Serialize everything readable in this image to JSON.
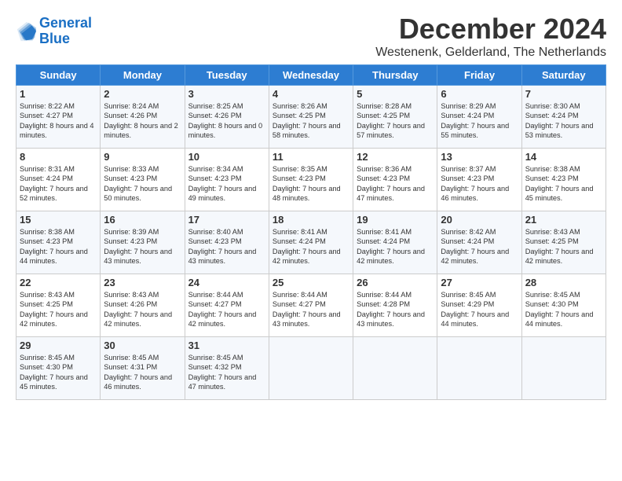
{
  "logo": {
    "line1": "General",
    "line2": "Blue"
  },
  "title": "December 2024",
  "subtitle": "Westenenk, Gelderland, The Netherlands",
  "days_of_week": [
    "Sunday",
    "Monday",
    "Tuesday",
    "Wednesday",
    "Thursday",
    "Friday",
    "Saturday"
  ],
  "weeks": [
    [
      {
        "day": "1",
        "sunrise": "Sunrise: 8:22 AM",
        "sunset": "Sunset: 4:27 PM",
        "daylight": "Daylight: 8 hours and 4 minutes."
      },
      {
        "day": "2",
        "sunrise": "Sunrise: 8:24 AM",
        "sunset": "Sunset: 4:26 PM",
        "daylight": "Daylight: 8 hours and 2 minutes."
      },
      {
        "day": "3",
        "sunrise": "Sunrise: 8:25 AM",
        "sunset": "Sunset: 4:26 PM",
        "daylight": "Daylight: 8 hours and 0 minutes."
      },
      {
        "day": "4",
        "sunrise": "Sunrise: 8:26 AM",
        "sunset": "Sunset: 4:25 PM",
        "daylight": "Daylight: 7 hours and 58 minutes."
      },
      {
        "day": "5",
        "sunrise": "Sunrise: 8:28 AM",
        "sunset": "Sunset: 4:25 PM",
        "daylight": "Daylight: 7 hours and 57 minutes."
      },
      {
        "day": "6",
        "sunrise": "Sunrise: 8:29 AM",
        "sunset": "Sunset: 4:24 PM",
        "daylight": "Daylight: 7 hours and 55 minutes."
      },
      {
        "day": "7",
        "sunrise": "Sunrise: 8:30 AM",
        "sunset": "Sunset: 4:24 PM",
        "daylight": "Daylight: 7 hours and 53 minutes."
      }
    ],
    [
      {
        "day": "8",
        "sunrise": "Sunrise: 8:31 AM",
        "sunset": "Sunset: 4:24 PM",
        "daylight": "Daylight: 7 hours and 52 minutes."
      },
      {
        "day": "9",
        "sunrise": "Sunrise: 8:33 AM",
        "sunset": "Sunset: 4:23 PM",
        "daylight": "Daylight: 7 hours and 50 minutes."
      },
      {
        "day": "10",
        "sunrise": "Sunrise: 8:34 AM",
        "sunset": "Sunset: 4:23 PM",
        "daylight": "Daylight: 7 hours and 49 minutes."
      },
      {
        "day": "11",
        "sunrise": "Sunrise: 8:35 AM",
        "sunset": "Sunset: 4:23 PM",
        "daylight": "Daylight: 7 hours and 48 minutes."
      },
      {
        "day": "12",
        "sunrise": "Sunrise: 8:36 AM",
        "sunset": "Sunset: 4:23 PM",
        "daylight": "Daylight: 7 hours and 47 minutes."
      },
      {
        "day": "13",
        "sunrise": "Sunrise: 8:37 AM",
        "sunset": "Sunset: 4:23 PM",
        "daylight": "Daylight: 7 hours and 46 minutes."
      },
      {
        "day": "14",
        "sunrise": "Sunrise: 8:38 AM",
        "sunset": "Sunset: 4:23 PM",
        "daylight": "Daylight: 7 hours and 45 minutes."
      }
    ],
    [
      {
        "day": "15",
        "sunrise": "Sunrise: 8:38 AM",
        "sunset": "Sunset: 4:23 PM",
        "daylight": "Daylight: 7 hours and 44 minutes."
      },
      {
        "day": "16",
        "sunrise": "Sunrise: 8:39 AM",
        "sunset": "Sunset: 4:23 PM",
        "daylight": "Daylight: 7 hours and 43 minutes."
      },
      {
        "day": "17",
        "sunrise": "Sunrise: 8:40 AM",
        "sunset": "Sunset: 4:23 PM",
        "daylight": "Daylight: 7 hours and 43 minutes."
      },
      {
        "day": "18",
        "sunrise": "Sunrise: 8:41 AM",
        "sunset": "Sunset: 4:24 PM",
        "daylight": "Daylight: 7 hours and 42 minutes."
      },
      {
        "day": "19",
        "sunrise": "Sunrise: 8:41 AM",
        "sunset": "Sunset: 4:24 PM",
        "daylight": "Daylight: 7 hours and 42 minutes."
      },
      {
        "day": "20",
        "sunrise": "Sunrise: 8:42 AM",
        "sunset": "Sunset: 4:24 PM",
        "daylight": "Daylight: 7 hours and 42 minutes."
      },
      {
        "day": "21",
        "sunrise": "Sunrise: 8:43 AM",
        "sunset": "Sunset: 4:25 PM",
        "daylight": "Daylight: 7 hours and 42 minutes."
      }
    ],
    [
      {
        "day": "22",
        "sunrise": "Sunrise: 8:43 AM",
        "sunset": "Sunset: 4:25 PM",
        "daylight": "Daylight: 7 hours and 42 minutes."
      },
      {
        "day": "23",
        "sunrise": "Sunrise: 8:43 AM",
        "sunset": "Sunset: 4:26 PM",
        "daylight": "Daylight: 7 hours and 42 minutes."
      },
      {
        "day": "24",
        "sunrise": "Sunrise: 8:44 AM",
        "sunset": "Sunset: 4:27 PM",
        "daylight": "Daylight: 7 hours and 42 minutes."
      },
      {
        "day": "25",
        "sunrise": "Sunrise: 8:44 AM",
        "sunset": "Sunset: 4:27 PM",
        "daylight": "Daylight: 7 hours and 43 minutes."
      },
      {
        "day": "26",
        "sunrise": "Sunrise: 8:44 AM",
        "sunset": "Sunset: 4:28 PM",
        "daylight": "Daylight: 7 hours and 43 minutes."
      },
      {
        "day": "27",
        "sunrise": "Sunrise: 8:45 AM",
        "sunset": "Sunset: 4:29 PM",
        "daylight": "Daylight: 7 hours and 44 minutes."
      },
      {
        "day": "28",
        "sunrise": "Sunrise: 8:45 AM",
        "sunset": "Sunset: 4:30 PM",
        "daylight": "Daylight: 7 hours and 44 minutes."
      }
    ],
    [
      {
        "day": "29",
        "sunrise": "Sunrise: 8:45 AM",
        "sunset": "Sunset: 4:30 PM",
        "daylight": "Daylight: 7 hours and 45 minutes."
      },
      {
        "day": "30",
        "sunrise": "Sunrise: 8:45 AM",
        "sunset": "Sunset: 4:31 PM",
        "daylight": "Daylight: 7 hours and 46 minutes."
      },
      {
        "day": "31",
        "sunrise": "Sunrise: 8:45 AM",
        "sunset": "Sunset: 4:32 PM",
        "daylight": "Daylight: 7 hours and 47 minutes."
      },
      null,
      null,
      null,
      null
    ]
  ]
}
